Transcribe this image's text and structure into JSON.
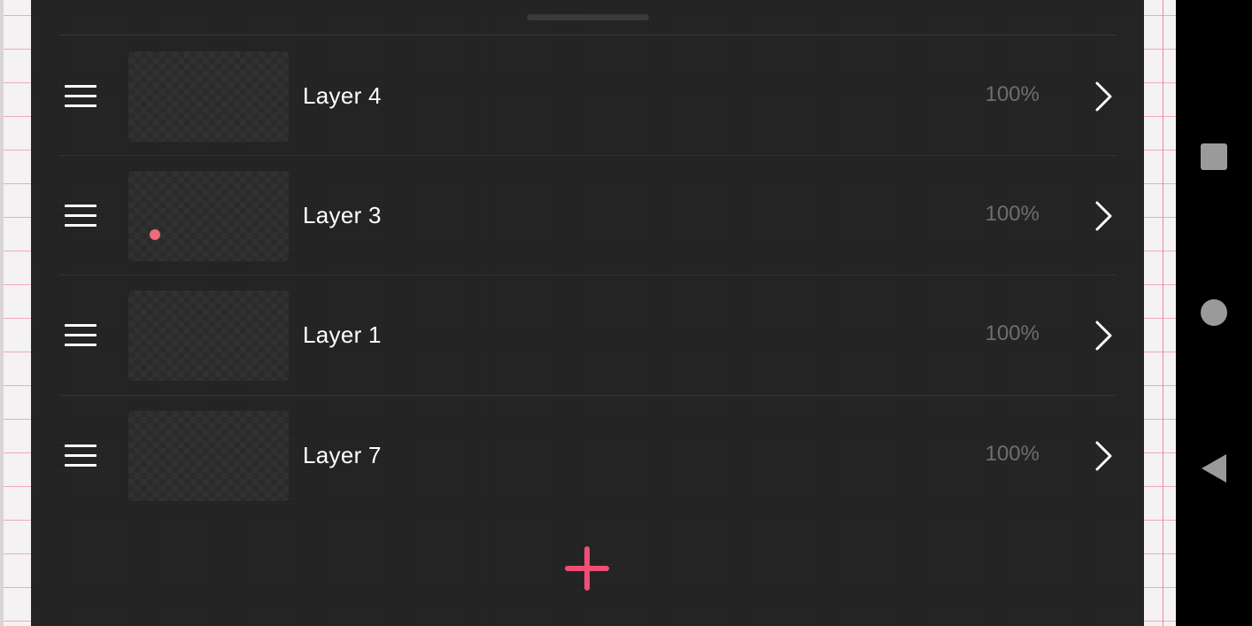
{
  "colors": {
    "sheet_bg": "#222222",
    "accent": "#f04e74",
    "text_primary": "#ffffff",
    "text_secondary": "#6e6e6e",
    "nav_bar": "#000000",
    "nav_icon": "#9a9a9a"
  },
  "layers": {
    "items": [
      {
        "name": "Layer 4",
        "opacity": "100%",
        "has_content_dot": false
      },
      {
        "name": "Layer 3",
        "opacity": "100%",
        "has_content_dot": true
      },
      {
        "name": "Layer 1",
        "opacity": "100%",
        "has_content_dot": false
      },
      {
        "name": "Layer 7",
        "opacity": "100%",
        "has_content_dot": false
      }
    ]
  },
  "icons": {
    "drag_handle": "sheet-drag-handle",
    "reorder": "hamburger-icon",
    "open": "chevron-right-icon",
    "add": "plus-icon",
    "nav_recents": "square-icon",
    "nav_home": "circle-icon",
    "nav_back": "triangle-back-icon"
  }
}
